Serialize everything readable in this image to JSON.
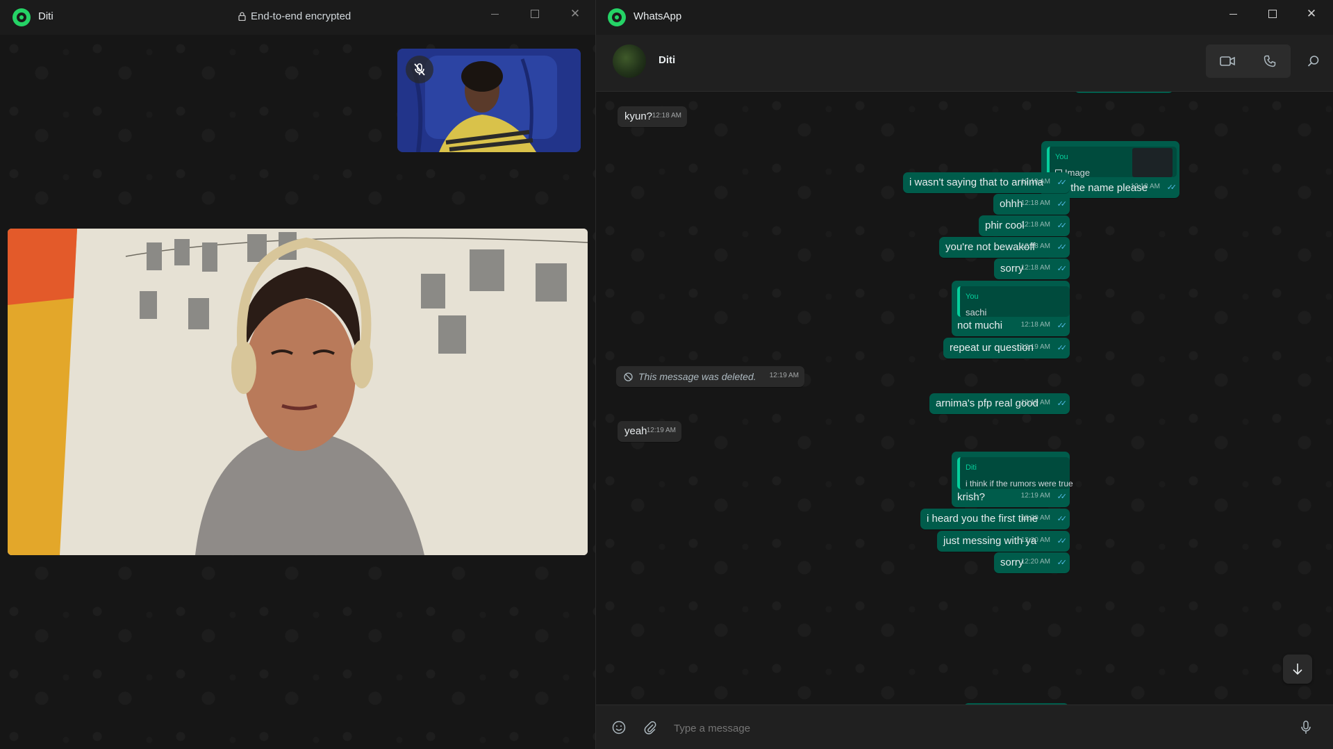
{
  "call": {
    "title": "Diti",
    "encryption": "End-to-end encrypted"
  },
  "app": {
    "title": "WhatsApp"
  },
  "chat": {
    "contact_name": "Diti",
    "composer_placeholder": "Type a message",
    "messages": [
      {
        "dir": "in",
        "text": "kyun?",
        "time": "12:18 AM"
      },
      {
        "dir": "out",
        "quote_author": "You",
        "quote_text": "Image",
        "text": "read the name please",
        "time": "12:18 AM"
      },
      {
        "dir": "out",
        "text": "i wasn't saying that to arnima",
        "time": "12:18 AM"
      },
      {
        "dir": "out",
        "text": "ohhh",
        "time": "12:18 AM"
      },
      {
        "dir": "out",
        "text": "phir cool",
        "time": "12:18 AM"
      },
      {
        "dir": "out",
        "text": "you're not bewakoff",
        "time": "12:18 AM"
      },
      {
        "dir": "out",
        "text": "sorry",
        "time": "12:18 AM"
      },
      {
        "dir": "out",
        "quote_author": "You",
        "quote_text": "sachi",
        "text": "not muchi",
        "time": "12:18 AM"
      },
      {
        "dir": "out",
        "text": "repeat ur question",
        "time": "12:19 AM"
      },
      {
        "dir": "in",
        "deleted": true,
        "text": "This message was deleted.",
        "time": "12:19 AM"
      },
      {
        "dir": "out",
        "text": "arnima's pfp real good",
        "time": "12:19 AM"
      },
      {
        "dir": "in",
        "text": "yeah",
        "time": "12:19 AM"
      },
      {
        "dir": "out",
        "quote_author": "Diti",
        "quote_text": "i think if the rumors were true",
        "text": "krish?",
        "time": "12:19 AM"
      },
      {
        "dir": "out",
        "text": "i heard you the first time",
        "time": "12:20 AM"
      },
      {
        "dir": "out",
        "text": "just messing with ya",
        "time": "12:20 AM"
      },
      {
        "dir": "out",
        "text": "sorry",
        "time": "12:20 AM"
      }
    ]
  },
  "colors": {
    "accent": "#25d366",
    "outgoing_bubble": "#005c4b",
    "incoming_bubble": "#2a2a2a",
    "read_tick": "#53bdeb"
  },
  "icons": [
    "whatsapp-logo-icon",
    "lock-icon",
    "minimize-icon",
    "maximize-icon",
    "close-icon",
    "mic-off-icon",
    "video-call-icon",
    "voice-call-icon",
    "search-icon",
    "emoji-icon",
    "attach-icon",
    "microphone-icon",
    "scroll-down-icon",
    "deleted-icon",
    "image-icon",
    "read-receipt-icon"
  ]
}
